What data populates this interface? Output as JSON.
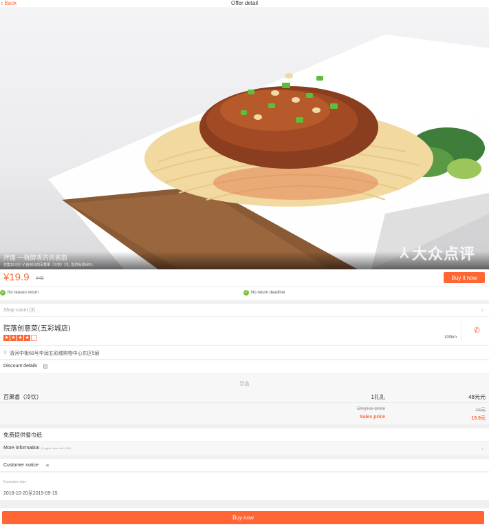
{
  "nav": {
    "back_label": "Back",
    "title": "Offer detail"
  },
  "hero": {
    "title": "拌面 一碗醇香的肉酱面",
    "subtitle": "仅售19.9元! 价值48元的百香果（冷饮）1扎, 提供免费WiFi。",
    "watermark": "大众点评"
  },
  "price": {
    "current": "¥19.9",
    "original": "¥48",
    "buy_label": "Buy it now"
  },
  "guarantees": [
    "No reason return",
    "No return deadline"
  ],
  "shop_count_label": "Shop count (3)",
  "shop": {
    "name": "院落创意菜(五彩城店)",
    "rating_stars": 4,
    "rating_max": 5,
    "distance": "100km"
  },
  "address": "清河中街68号华润五彩城购物中心东区5层",
  "discount": {
    "heading": "Discount details",
    "category": "饮品",
    "item": {
      "name": "百果香（冷饮）",
      "qty": "1扎扎",
      "amount": "48元元"
    },
    "original_label": "Original price",
    "original_value": "48元",
    "sales_label": "Sales price",
    "sales_value": "19.9元"
  },
  "free_napkin": "免费提供餐巾纸",
  "more_info": {
    "label": "More information",
    "sub": "(Suggest open with Wifi)"
  },
  "notice": {
    "heading": "Customer notice",
    "expiration_label": "Expiration date",
    "expiration_value": "2018-10-20至2019-09-15"
  },
  "footer": {
    "buy_label": "Buy now"
  },
  "colors": {
    "accent": "#ff6633",
    "green": "#7ac142"
  }
}
